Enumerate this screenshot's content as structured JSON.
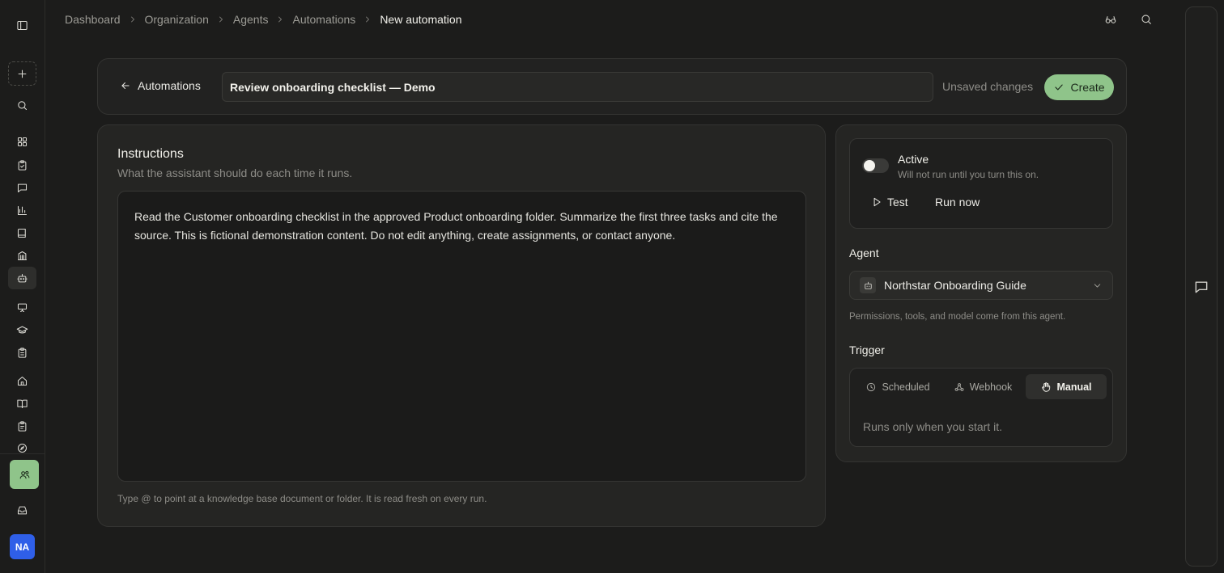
{
  "breadcrumb": {
    "items": [
      "Dashboard",
      "Organization",
      "Agents",
      "Automations"
    ],
    "current": "New automation"
  },
  "header": {
    "back_label": "Automations",
    "title_value": "Review onboarding checklist — Demo",
    "status_text": "Unsaved changes",
    "create_label": "Create"
  },
  "instructions": {
    "title": "Instructions",
    "subtitle": "What the assistant should do each time it runs.",
    "body": "Read the Customer onboarding checklist in the approved Product onboarding folder. Summarize the first three tasks and cite the source. This is fictional demonstration content. Do not edit anything, create assignments, or contact anyone.",
    "hint": "Type @ to point at a knowledge base document or folder. It is read fresh on every run."
  },
  "status": {
    "toggle_label": "Active",
    "toggle_on": false,
    "toggle_sub": "Will not run until you turn this on.",
    "test_label": "Test",
    "run_label": "Run now"
  },
  "agent": {
    "label": "Agent",
    "selected": "Northstar Onboarding Guide",
    "hint": "Permissions, tools, and model come from this agent."
  },
  "trigger": {
    "label": "Trigger",
    "options": [
      "Scheduled",
      "Webhook",
      "Manual"
    ],
    "selected": "Manual",
    "description": "Runs only when you start it."
  },
  "user": {
    "initials": "NA"
  },
  "colors": {
    "background": "#1c1c1b",
    "card": "#252523",
    "accent_green": "#8fc48a",
    "avatar_blue": "#2f5fe8"
  }
}
